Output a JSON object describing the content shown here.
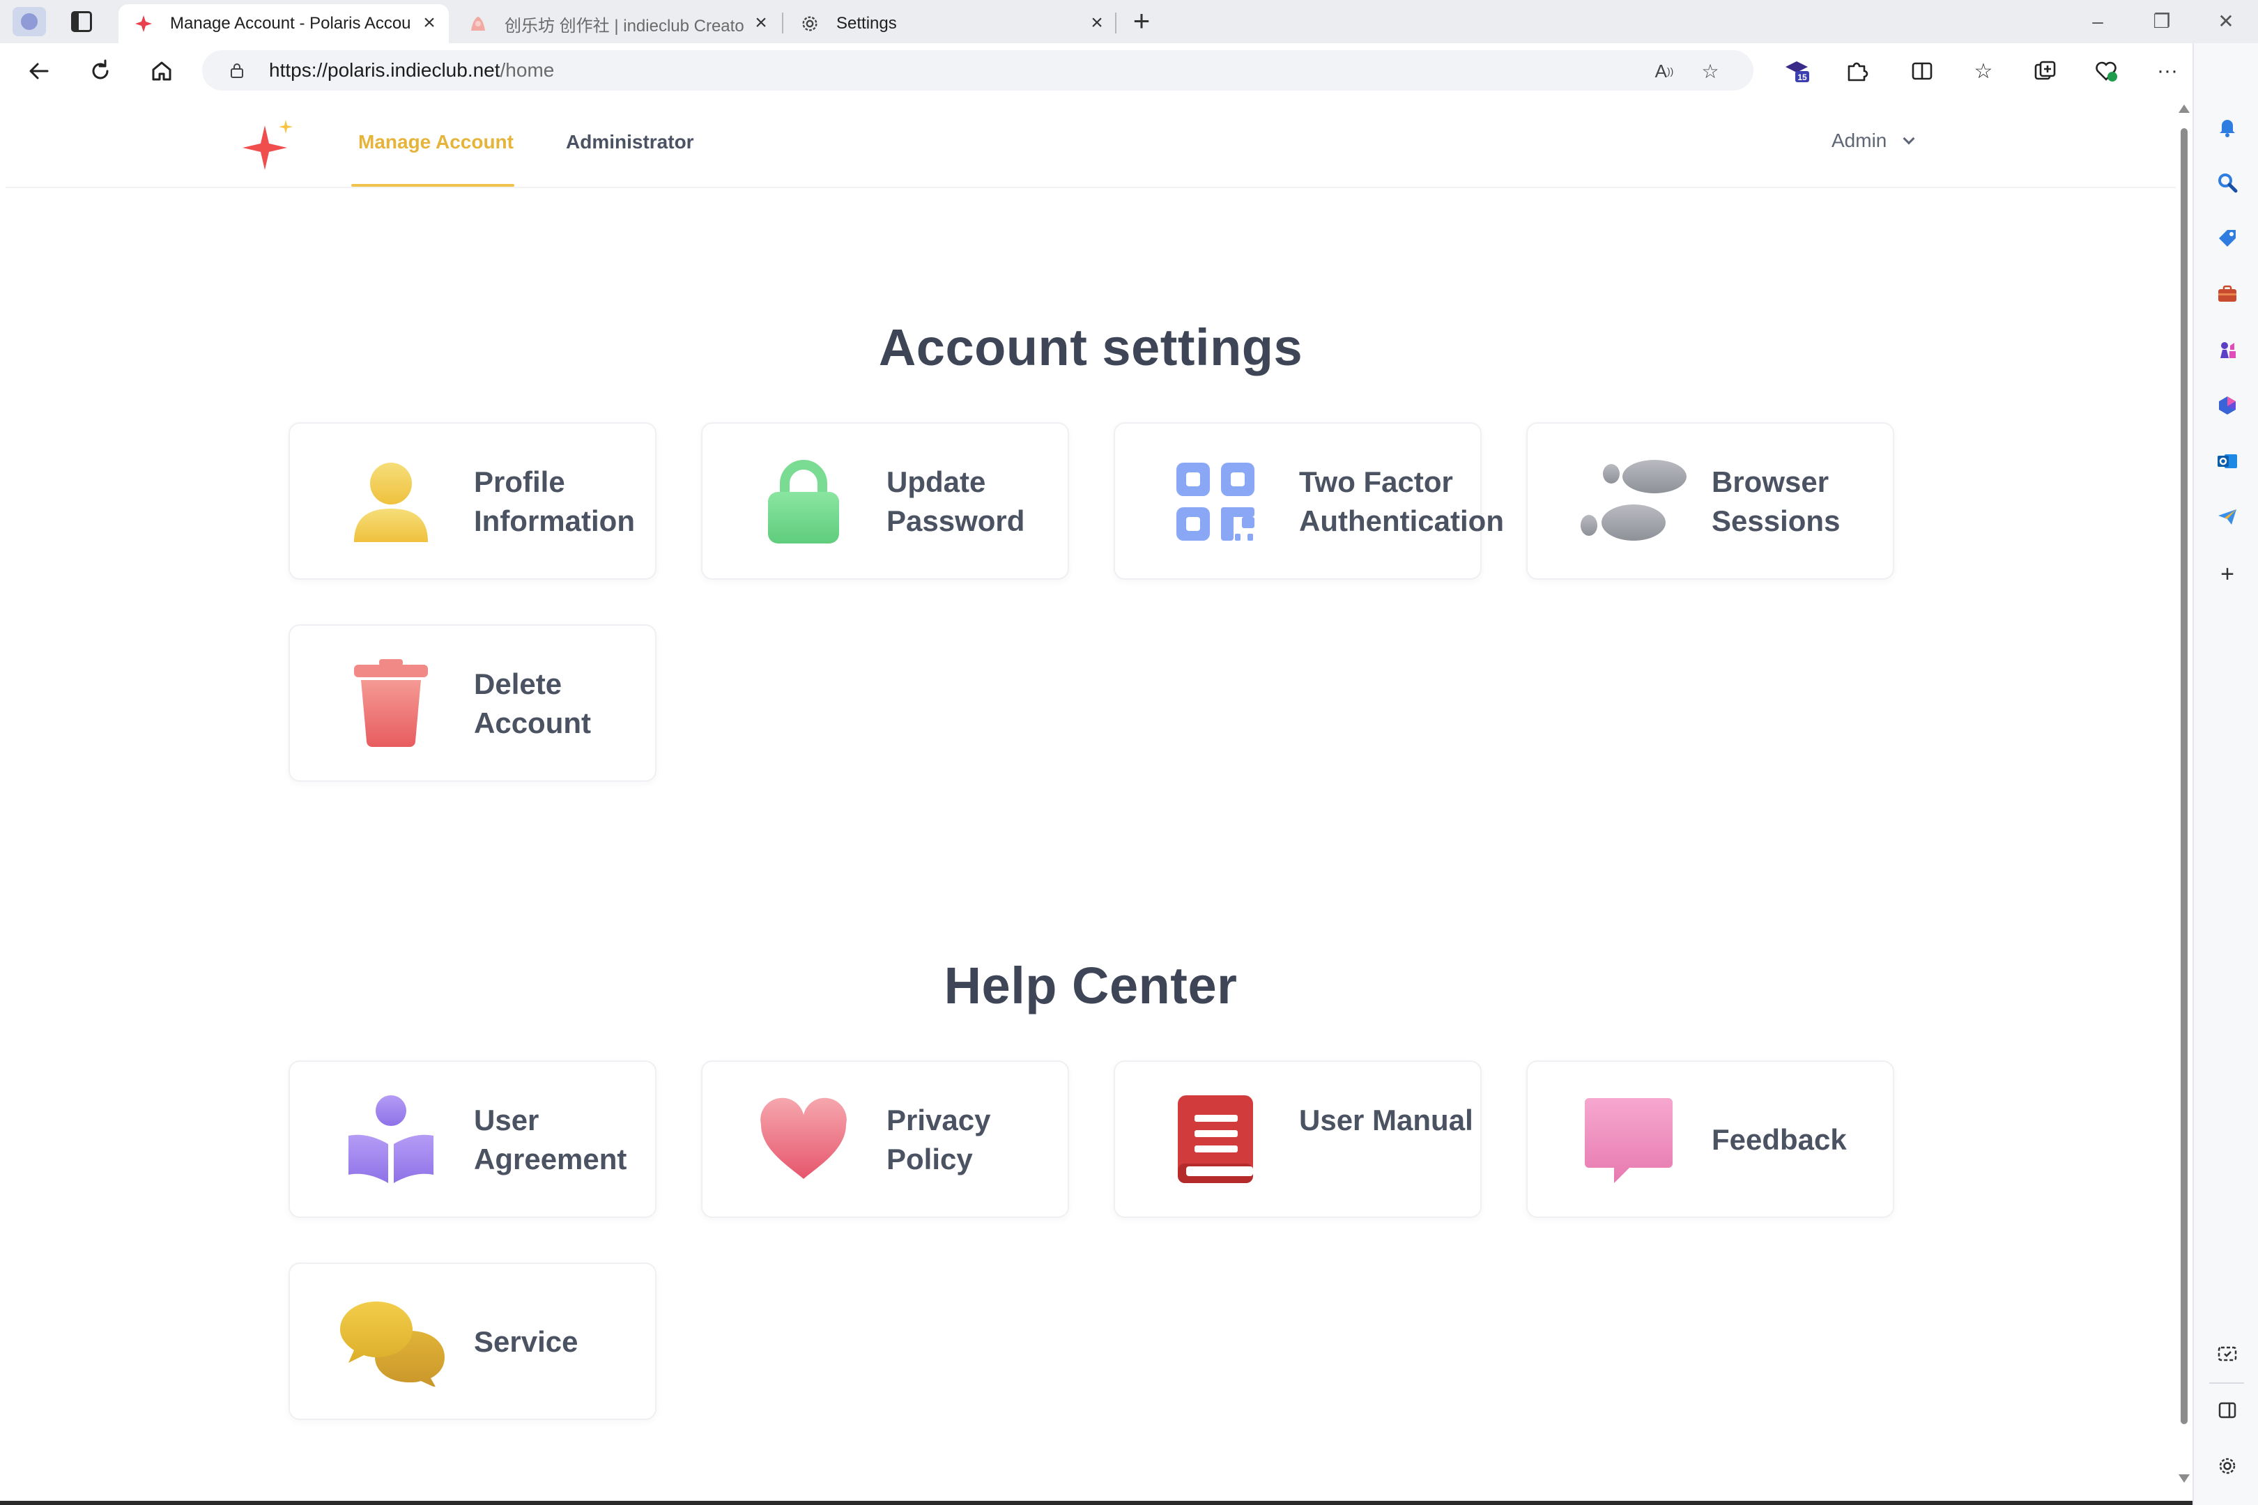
{
  "browser": {
    "tabs": [
      {
        "title": "Manage Account - Polaris Accou",
        "active": true
      },
      {
        "title": "创乐坊 创作社 | indieclub Creato",
        "active": false
      },
      {
        "title": "Settings",
        "active": false
      }
    ],
    "url_host": "https://polaris.indieclub.net",
    "url_path": "/home",
    "collections_badge": "15"
  },
  "header": {
    "nav": [
      {
        "label": "Manage Account",
        "active": true
      },
      {
        "label": "Administrator",
        "active": false
      }
    ],
    "user_menu": "Admin"
  },
  "account_settings": {
    "title": "Account settings",
    "cards": [
      {
        "label": "Profile Information",
        "icon": "user-icon",
        "color": "#f2cf55"
      },
      {
        "label": "Update Password",
        "icon": "lock-icon",
        "color": "#6fd68c"
      },
      {
        "label": "Two Factor Authentication",
        "icon": "qr-code-icon",
        "color": "#8aa7f5"
      },
      {
        "label": "Browser Sessions",
        "icon": "footprints-icon",
        "color": "#9a9ca3"
      },
      {
        "label": "Delete Account",
        "icon": "trash-icon",
        "color": "#ef6f6f"
      }
    ]
  },
  "help_center": {
    "title": "Help Center",
    "cards": [
      {
        "label": "User Agreement",
        "icon": "reader-icon",
        "color": "#a58bf0"
      },
      {
        "label": "Privacy Policy",
        "icon": "heart-icon",
        "color": "#f07585"
      },
      {
        "label": "User Manual",
        "icon": "book-icon",
        "color": "#d23b3b"
      },
      {
        "label": "Feedback",
        "icon": "chat-bubble-icon",
        "color": "#ef8fc0"
      },
      {
        "label": "Service",
        "icon": "chat-bubbles-icon",
        "color": "#e0b238"
      }
    ]
  },
  "colors": {
    "accent": "#e6b43a",
    "text": "#3d4556",
    "logo": "#f04d4d"
  }
}
